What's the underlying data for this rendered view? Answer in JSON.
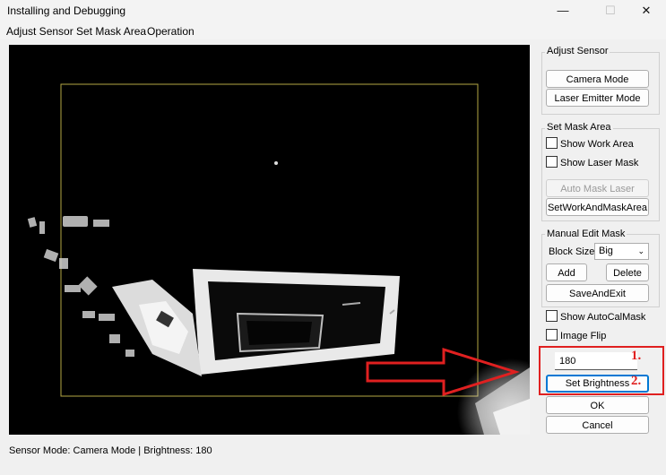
{
  "window": {
    "title": "Installing and Debugging",
    "minimize": "—",
    "maximize": "☐",
    "close": "✕"
  },
  "menu": [
    "Adjust Sensor",
    "Set Mask Area",
    "Operation"
  ],
  "status": {
    "text": "Sensor Mode: Camera Mode  |  Brightness: 180"
  },
  "adjust_sensor": {
    "title": "Adjust Sensor",
    "camera_mode": "Camera Mode",
    "laser_mode": "Laser Emitter Mode"
  },
  "set_mask": {
    "title": "Set Mask Area",
    "show_work_area": "Show Work Area",
    "show_laser_mask": "Show Laser Mask",
    "auto_mask_laser": "Auto Mask Laser",
    "set_work_mask": "SetWorkAndMaskArea"
  },
  "manual_edit": {
    "title": "Manual Edit Mask",
    "block_size_label": "Block Size:",
    "block_size_value": "Big",
    "add": "Add",
    "delete": "Delete",
    "save_exit": "SaveAndExit"
  },
  "options": {
    "show_autocal": "Show AutoCalMask",
    "image_flip": "Image Flip"
  },
  "brightness": {
    "value": "180",
    "set_label": "Set Brightness"
  },
  "ok": "OK",
  "cancel": "Cancel",
  "annotations": {
    "step1": "1.",
    "step2": "2.",
    "color": "#e02020"
  }
}
